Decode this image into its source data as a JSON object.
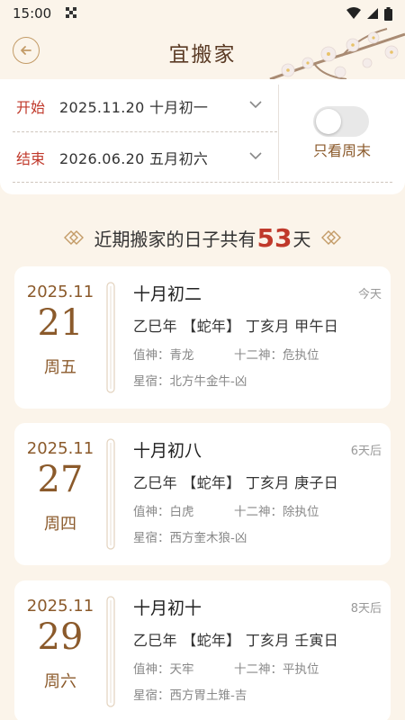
{
  "status_bar": {
    "time": "15:00"
  },
  "header": {
    "title": "宜搬家"
  },
  "filter": {
    "start_label": "开始",
    "start_value": "2025.11.20 十月初一",
    "end_label": "结束",
    "end_value": "2026.06.20 五月初六",
    "weekend_toggle_label": "只看周末",
    "weekend_only": false
  },
  "summary": {
    "prefix": "近期搬家的日子共有",
    "count": "53",
    "suffix": "天"
  },
  "days": [
    {
      "year_month": "2025.11",
      "day": "21",
      "weekday": "周五",
      "lunar": "十月初二",
      "relative": "今天",
      "ganzhi": "乙巳年 【蛇年】 丁亥月 甲午日",
      "zhishen": "值神：青龙",
      "shier": "十二神：危执位",
      "xingxiu": "星宿：北方牛金牛-凶"
    },
    {
      "year_month": "2025.11",
      "day": "27",
      "weekday": "周四",
      "lunar": "十月初八",
      "relative": "6天后",
      "ganzhi": "乙巳年 【蛇年】 丁亥月 庚子日",
      "zhishen": "值神：白虎",
      "shier": "十二神：除执位",
      "xingxiu": "星宿：西方奎木狼-凶"
    },
    {
      "year_month": "2025.11",
      "day": "29",
      "weekday": "周六",
      "lunar": "十月初十",
      "relative": "8天后",
      "ganzhi": "乙巳年 【蛇年】 丁亥月 壬寅日",
      "zhishen": "值神：天牢",
      "shier": "十二神：平执位",
      "xingxiu": "星宿：西方胃土雉-吉"
    }
  ],
  "colors": {
    "accent_red": "#c0392b",
    "brown": "#8b5a2b",
    "background": "#fbf4ea"
  },
  "icons": [
    "back-arrow-icon",
    "chevron-down-icon",
    "diamond-ornament-icon",
    "wifi-icon",
    "signal-icon",
    "battery-icon"
  ]
}
